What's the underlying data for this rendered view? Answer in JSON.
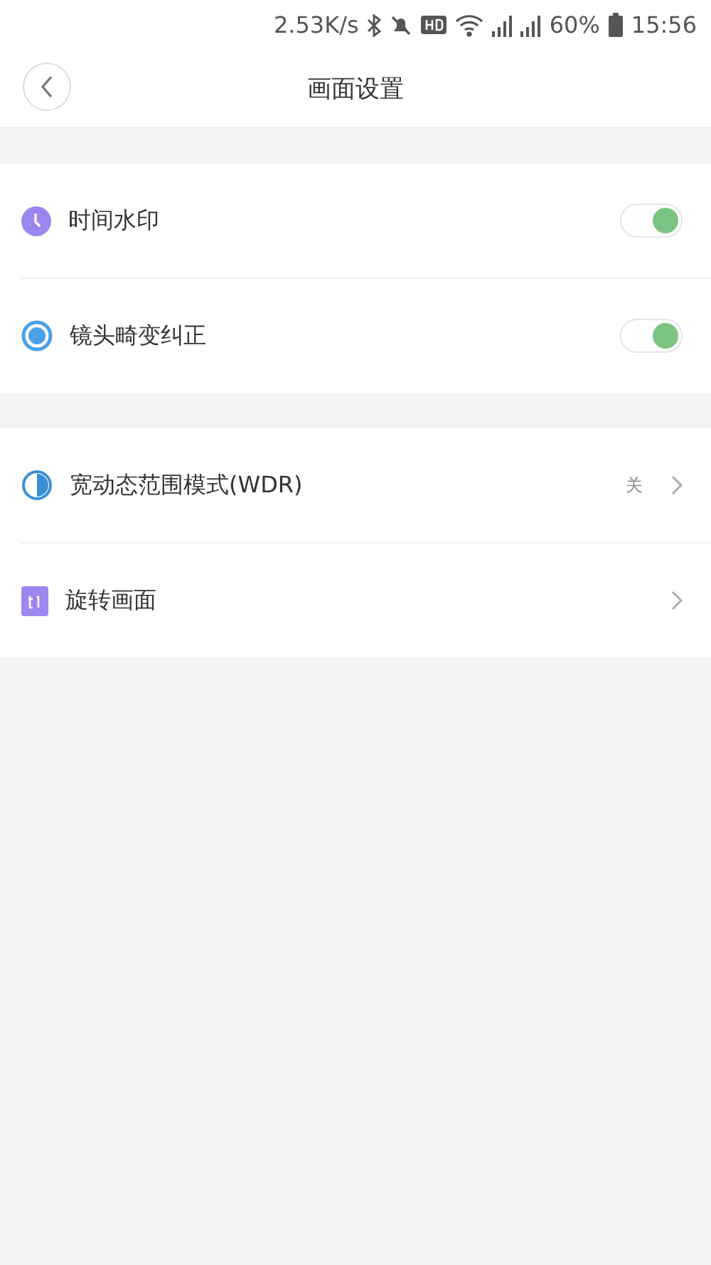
{
  "status_bar": {
    "speed": "2.53K/s",
    "battery": "60%",
    "time": "15:56"
  },
  "header": {
    "title": "画面设置"
  },
  "groups": [
    {
      "items": [
        {
          "kind": "toggle",
          "label": "时间水印",
          "on": true
        },
        {
          "kind": "toggle",
          "label": "镜头畸变纠正",
          "on": true
        }
      ]
    },
    {
      "items": [
        {
          "kind": "link",
          "label": "宽动态范围模式(WDR)",
          "value": "关"
        },
        {
          "kind": "link",
          "label": "旋转画面"
        }
      ]
    }
  ]
}
